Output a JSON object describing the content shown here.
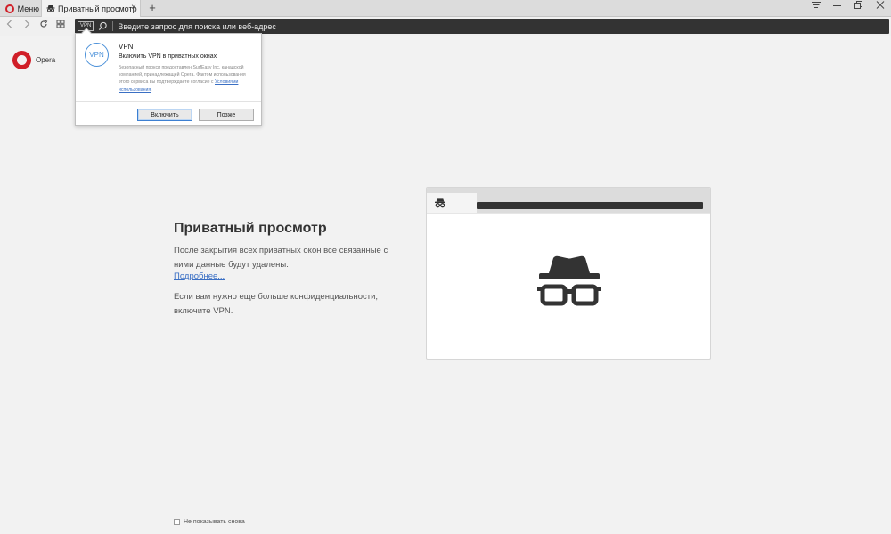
{
  "browser": {
    "menu_label": "Меню",
    "tab_title": "Приватный просмотр",
    "new_tab_symbol": "+",
    "address_placeholder": "Введите запрос для поиска или веб-адрес",
    "vpn_badge": "VPN",
    "logo_text": "Opera"
  },
  "vpn_popup": {
    "icon_text": "VPN",
    "title": "VPN",
    "subtitle": "Включить VPN в приватных окнах",
    "description": "Безопасный прокси предоставлен SurfEasy Inc, канадской компанией, принадлежащей Opera. Фактом использования этого сервиса вы подтверждаете согласие с",
    "terms_link": "Условиями использования",
    "terms_suffix": ".",
    "enable_button": "Включить",
    "later_button": "Позже",
    "accent": "#4a90d9"
  },
  "content": {
    "heading": "Приватный просмотр",
    "para1": "После закрытия всех приватных окон все связанные с ними данные будут удалены.",
    "more_link": "Подробнее...",
    "para2": "Если вам нужно еще больше конфиденциальности, включите VPN."
  },
  "footer": {
    "dont_show_label": "Не показывать снова"
  },
  "colors": {
    "opera_red": "#d01f28",
    "link_blue": "#3a6fc4"
  }
}
